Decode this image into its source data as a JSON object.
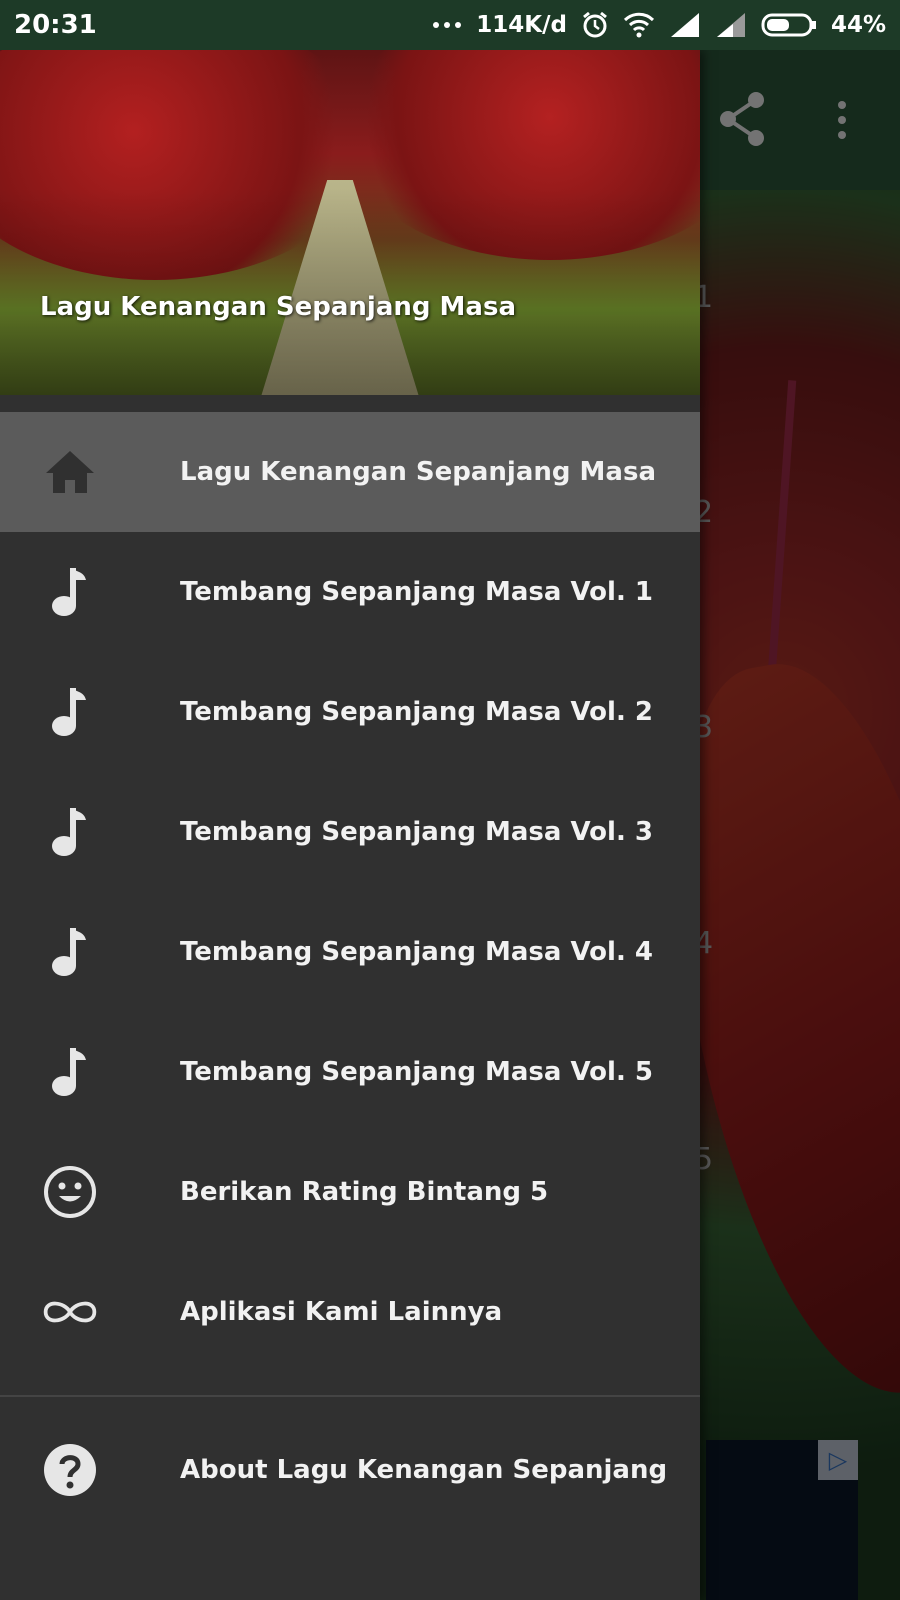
{
  "status_bar": {
    "time": "20:31",
    "network_speed": "114K/d",
    "battery": "44%",
    "icons": [
      "more-dots-icon",
      "alarm-icon",
      "wifi-icon",
      "signal-icon",
      "signal-icon-2",
      "battery-icon"
    ]
  },
  "background_app": {
    "toolbar_icons": [
      "share-icon",
      "more-vert-icon"
    ],
    "list_numbers": [
      "1",
      "2",
      "3",
      "4",
      "5"
    ]
  },
  "drawer": {
    "header_title": "Lagu Kenangan Sepanjang Masa",
    "items": [
      {
        "label": "Lagu Kenangan Sepanjang Masa",
        "icon": "home-icon",
        "active": true
      },
      {
        "label": "Tembang Sepanjang Masa Vol. 1",
        "icon": "music-note-icon"
      },
      {
        "label": "Tembang Sepanjang Masa Vol. 2",
        "icon": "music-note-icon"
      },
      {
        "label": "Tembang Sepanjang Masa Vol. 3",
        "icon": "music-note-icon"
      },
      {
        "label": "Tembang Sepanjang Masa Vol. 4",
        "icon": "music-note-icon"
      },
      {
        "label": "Tembang Sepanjang Masa Vol. 5",
        "icon": "music-note-icon"
      },
      {
        "label": "Berikan Rating Bintang 5",
        "icon": "smiley-icon"
      },
      {
        "label": "Aplikasi Kami Lainnya",
        "icon": "infinity-icon"
      }
    ],
    "footer_item": {
      "label": "About Lagu Kenangan Sepanjang",
      "icon": "help-icon"
    }
  },
  "colors": {
    "drawer_bg": "#303030",
    "active_item_bg": "#5b5b5b",
    "status_bar_bg": "#1d3a27"
  }
}
